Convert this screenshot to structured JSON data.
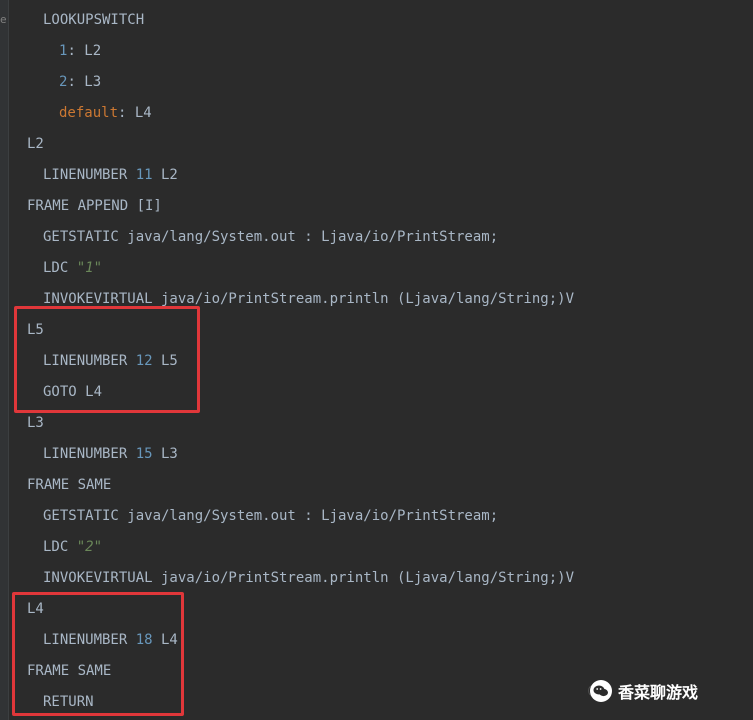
{
  "colors": {
    "background": "#2b2b2b",
    "text": "#a9b7c6",
    "number": "#6897bb",
    "keyword": "#cc7832",
    "string": "#6a8759",
    "highlight": "#e0373a"
  },
  "gutter": {
    "mark_label": "e"
  },
  "lines": [
    {
      "indent": 2,
      "segs": [
        {
          "t": "LOOKUPSWITCH",
          "c": "plain"
        }
      ]
    },
    {
      "indent": 4,
      "segs": [
        {
          "t": "1",
          "c": "num"
        },
        {
          "t": ": L2",
          "c": "plain"
        }
      ]
    },
    {
      "indent": 4,
      "segs": [
        {
          "t": "2",
          "c": "num"
        },
        {
          "t": ": L3",
          "c": "plain"
        }
      ]
    },
    {
      "indent": 4,
      "segs": [
        {
          "t": "default",
          "c": "kw"
        },
        {
          "t": ": L4",
          "c": "plain"
        }
      ]
    },
    {
      "indent": 0,
      "segs": [
        {
          "t": "L2",
          "c": "plain"
        }
      ]
    },
    {
      "indent": 2,
      "segs": [
        {
          "t": "LINENUMBER ",
          "c": "plain"
        },
        {
          "t": "11",
          "c": "num"
        },
        {
          "t": " L2",
          "c": "plain"
        }
      ]
    },
    {
      "indent": 0,
      "segs": [
        {
          "t": "FRAME APPEND [I]",
          "c": "plain"
        }
      ]
    },
    {
      "indent": 2,
      "segs": [
        {
          "t": "GETSTATIC java/lang/System.out : Ljava/io/PrintStream;",
          "c": "plain"
        }
      ]
    },
    {
      "indent": 2,
      "segs": [
        {
          "t": "LDC ",
          "c": "plain"
        },
        {
          "t": "\"1\"",
          "c": "str"
        }
      ]
    },
    {
      "indent": 2,
      "segs": [
        {
          "t": "INVOKEVIRTUAL java/io/PrintStream.println (Ljava/lang/String;)V",
          "c": "plain"
        }
      ]
    },
    {
      "indent": 0,
      "segs": [
        {
          "t": "L5",
          "c": "plain"
        }
      ]
    },
    {
      "indent": 2,
      "segs": [
        {
          "t": "LINENUMBER ",
          "c": "plain"
        },
        {
          "t": "12",
          "c": "num"
        },
        {
          "t": " L5",
          "c": "plain"
        }
      ]
    },
    {
      "indent": 2,
      "segs": [
        {
          "t": "GOTO L4",
          "c": "plain"
        }
      ]
    },
    {
      "indent": 0,
      "segs": [
        {
          "t": "L3",
          "c": "plain"
        }
      ]
    },
    {
      "indent": 2,
      "segs": [
        {
          "t": "LINENUMBER ",
          "c": "plain"
        },
        {
          "t": "15",
          "c": "num"
        },
        {
          "t": " L3",
          "c": "plain"
        }
      ]
    },
    {
      "indent": 0,
      "segs": [
        {
          "t": "FRAME SAME",
          "c": "plain"
        }
      ]
    },
    {
      "indent": 2,
      "segs": [
        {
          "t": "GETSTATIC java/lang/System.out : Ljava/io/PrintStream;",
          "c": "plain"
        }
      ]
    },
    {
      "indent": 2,
      "segs": [
        {
          "t": "LDC ",
          "c": "plain"
        },
        {
          "t": "\"2\"",
          "c": "str"
        }
      ]
    },
    {
      "indent": 2,
      "segs": [
        {
          "t": "INVOKEVIRTUAL java/io/PrintStream.println (Ljava/lang/String;)V",
          "c": "plain"
        }
      ]
    },
    {
      "indent": 0,
      "segs": [
        {
          "t": "L4",
          "c": "plain"
        }
      ]
    },
    {
      "indent": 2,
      "segs": [
        {
          "t": "LINENUMBER ",
          "c": "plain"
        },
        {
          "t": "18",
          "c": "num"
        },
        {
          "t": " L4",
          "c": "plain"
        }
      ]
    },
    {
      "indent": 0,
      "segs": [
        {
          "t": "FRAME SAME",
          "c": "plain"
        }
      ]
    },
    {
      "indent": 2,
      "segs": [
        {
          "t": "RETURN",
          "c": "plain"
        }
      ]
    }
  ],
  "highlights": [
    {
      "from_line": 10,
      "to_line": 12
    },
    {
      "from_line": 19,
      "to_line": 22
    }
  ],
  "watermark": {
    "text": "香菜聊游戏",
    "icon": "wechat-icon",
    "faint_prefix": "@"
  }
}
